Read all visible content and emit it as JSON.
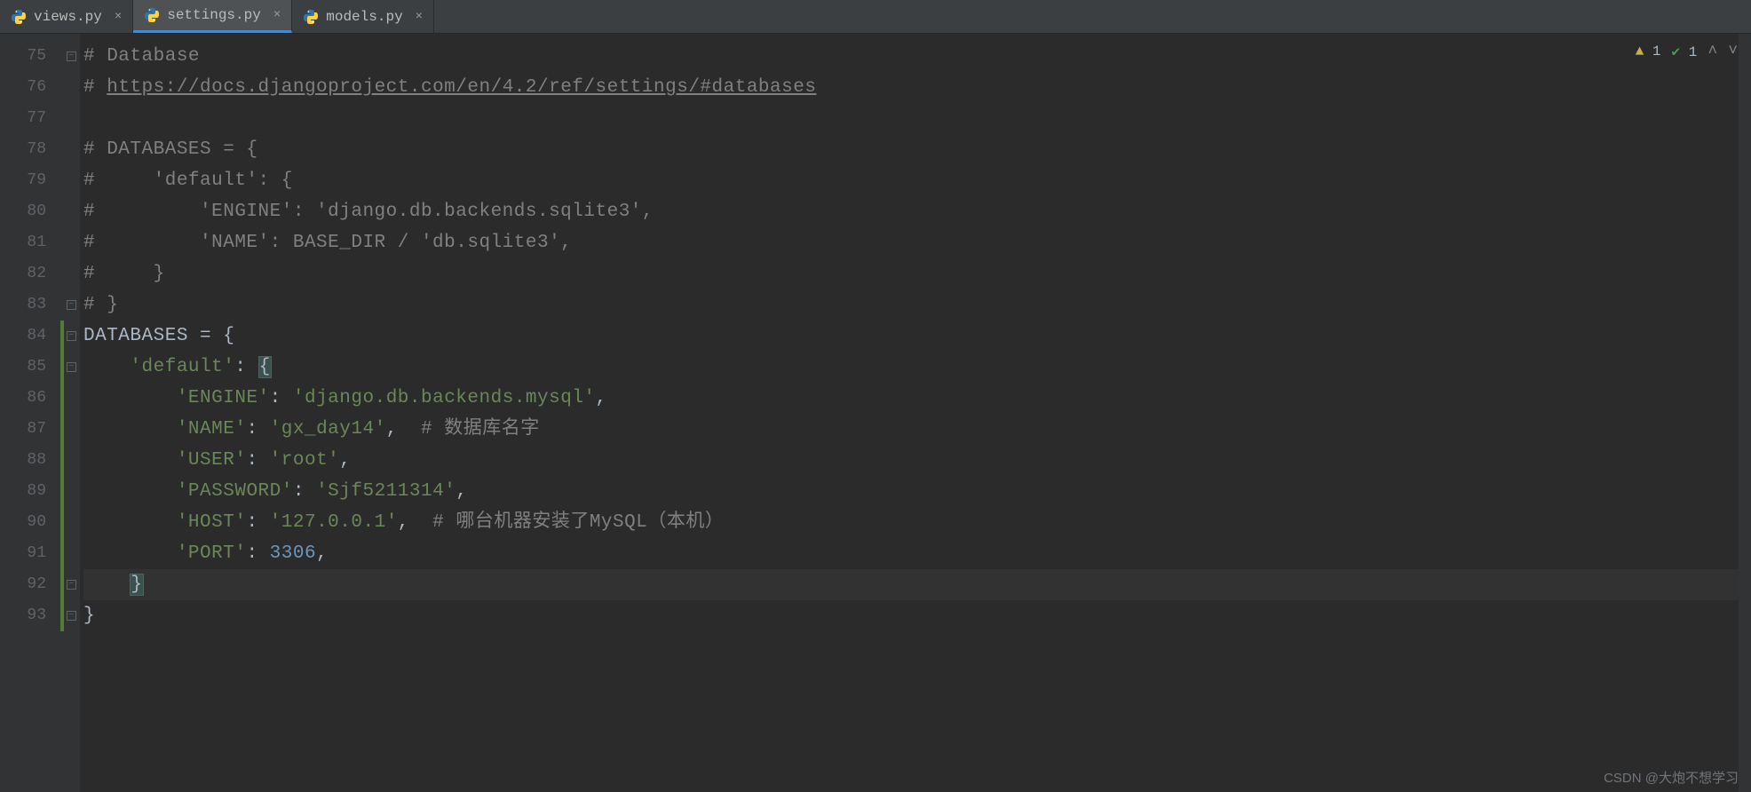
{
  "tabs": [
    {
      "label": "views.py",
      "active": false
    },
    {
      "label": "settings.py",
      "active": true
    },
    {
      "label": "models.py",
      "active": false
    }
  ],
  "inspections": {
    "warning_count": "1",
    "pass_count": "1"
  },
  "line_start": 75,
  "code_lines": [
    {
      "num": 75,
      "fold": "open",
      "tokens": [
        [
          "comment",
          "# Database"
        ]
      ]
    },
    {
      "num": 76,
      "tokens": [
        [
          "comment",
          "# "
        ],
        [
          "comment-link",
          "https://docs.djangoproject.com/en/4.2/ref/settings/#databases"
        ]
      ]
    },
    {
      "num": 77,
      "tokens": [
        [
          "identifier",
          ""
        ]
      ]
    },
    {
      "num": 78,
      "tokens": [
        [
          "comment",
          "# DATABASES = {"
        ]
      ]
    },
    {
      "num": 79,
      "tokens": [
        [
          "comment",
          "#     'default': {"
        ]
      ]
    },
    {
      "num": 80,
      "tokens": [
        [
          "comment",
          "#         'ENGINE': 'django.db.backends.sqlite3',"
        ]
      ]
    },
    {
      "num": 81,
      "tokens": [
        [
          "comment",
          "#         'NAME': BASE_DIR / 'db.sqlite3',"
        ]
      ]
    },
    {
      "num": 82,
      "tokens": [
        [
          "comment",
          "#     }"
        ]
      ]
    },
    {
      "num": 83,
      "fold": "close",
      "tokens": [
        [
          "comment",
          "# }"
        ]
      ]
    },
    {
      "num": 84,
      "fold": "open",
      "vcs": true,
      "tokens": [
        [
          "identifier",
          "DATABASES "
        ],
        [
          "operator",
          "= "
        ],
        [
          "brace",
          "{"
        ]
      ]
    },
    {
      "num": 85,
      "fold": "open",
      "vcs": true,
      "tokens": [
        [
          "identifier",
          "    "
        ],
        [
          "string",
          "'default'"
        ],
        [
          "operator",
          ": "
        ],
        [
          "brace-match",
          "{"
        ]
      ]
    },
    {
      "num": 86,
      "vcs": true,
      "tokens": [
        [
          "identifier",
          "        "
        ],
        [
          "string",
          "'ENGINE'"
        ],
        [
          "operator",
          ": "
        ],
        [
          "string",
          "'django.db.backends.mysql'"
        ],
        [
          "operator",
          ","
        ]
      ]
    },
    {
      "num": 87,
      "vcs": true,
      "tokens": [
        [
          "identifier",
          "        "
        ],
        [
          "string",
          "'NAME'"
        ],
        [
          "operator",
          ": "
        ],
        [
          "string",
          "'gx_day14'"
        ],
        [
          "operator",
          ",  "
        ],
        [
          "comment",
          "# 数据库名字"
        ]
      ]
    },
    {
      "num": 88,
      "vcs": true,
      "tokens": [
        [
          "identifier",
          "        "
        ],
        [
          "string",
          "'USER'"
        ],
        [
          "operator",
          ": "
        ],
        [
          "string",
          "'root'"
        ],
        [
          "operator",
          ","
        ]
      ]
    },
    {
      "num": 89,
      "vcs": true,
      "tokens": [
        [
          "identifier",
          "        "
        ],
        [
          "string",
          "'PASSWORD'"
        ],
        [
          "operator",
          ": "
        ],
        [
          "string",
          "'Sjf5211314'"
        ],
        [
          "operator",
          ","
        ]
      ]
    },
    {
      "num": 90,
      "vcs": true,
      "tokens": [
        [
          "identifier",
          "        "
        ],
        [
          "string",
          "'HOST'"
        ],
        [
          "operator",
          ": "
        ],
        [
          "string",
          "'127.0.0.1'"
        ],
        [
          "operator",
          ",  "
        ],
        [
          "comment",
          "# 哪台机器安装了MySQL（本机）"
        ]
      ]
    },
    {
      "num": 91,
      "vcs": true,
      "tokens": [
        [
          "identifier",
          "        "
        ],
        [
          "string",
          "'PORT'"
        ],
        [
          "operator",
          ": "
        ],
        [
          "number",
          "3306"
        ],
        [
          "operator",
          ","
        ]
      ]
    },
    {
      "num": 92,
      "fold": "close",
      "vcs": true,
      "current": true,
      "tokens": [
        [
          "identifier",
          "    "
        ],
        [
          "brace-match",
          "}"
        ]
      ]
    },
    {
      "num": 93,
      "fold": "close",
      "vcs": true,
      "tokens": [
        [
          "brace",
          "}"
        ]
      ]
    }
  ],
  "watermark": "CSDN @大炮不想学习"
}
